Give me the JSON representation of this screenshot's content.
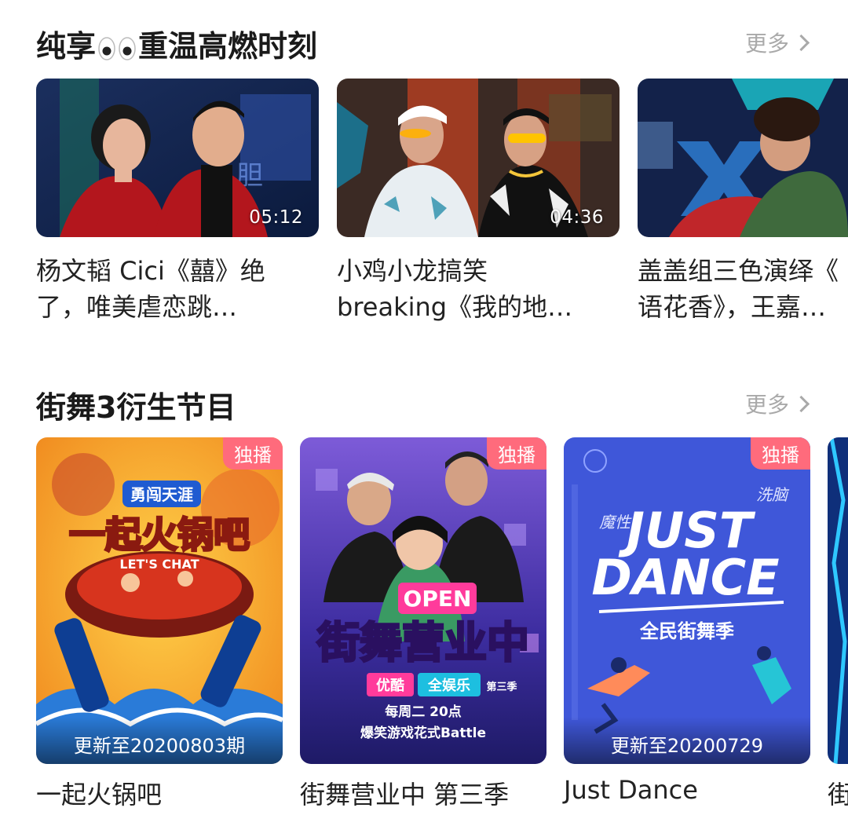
{
  "sections": [
    {
      "title_a": "纯享",
      "title_b": "重温高燃时刻",
      "more": "更多",
      "items": [
        {
          "line1": "杨文韬 Cici《囍》绝",
          "line2": "了，唯美虐恋跳…",
          "duration": "05:12"
        },
        {
          "line1": "小鸡小龙搞笑",
          "line2": "breaking《我的地…",
          "duration": "04:36"
        },
        {
          "line1": "盖盖组三色演绎《",
          "line2": "语花香》，王嘉…",
          "duration": ""
        }
      ]
    },
    {
      "title": "街舞3衍生节目",
      "more": "更多",
      "items": [
        {
          "name": "一起火锅吧",
          "badge": "独播",
          "update": "更新至20200803期",
          "poster_main": "一起火锅吧",
          "poster_sub": "LET'S CHAT",
          "poster_logo": "勇闯天涯"
        },
        {
          "name": "街舞营业中 第三季",
          "badge": "独播",
          "update": "",
          "poster_open": "OPEN",
          "poster_main": "街舞营业中",
          "poster_tag1": "优酷",
          "poster_tag2": "全娱乐",
          "poster_tag3": "第三季",
          "poster_l1": "每周二 20点",
          "poster_l2": "爆笑游戏花式Battle"
        },
        {
          "name": "Just Dance",
          "badge": "独播",
          "update": "更新至20200729",
          "poster_main1": "JUST",
          "poster_main2": "DANCE",
          "poster_sub": "全民街舞季",
          "poster_left": "魔性",
          "poster_right": "洗脑"
        },
        {
          "name": "街"
        }
      ]
    }
  ],
  "colors": {
    "badge": "#ff6b7c",
    "more": "#a9a9a9",
    "title": "#1a1a1a"
  }
}
